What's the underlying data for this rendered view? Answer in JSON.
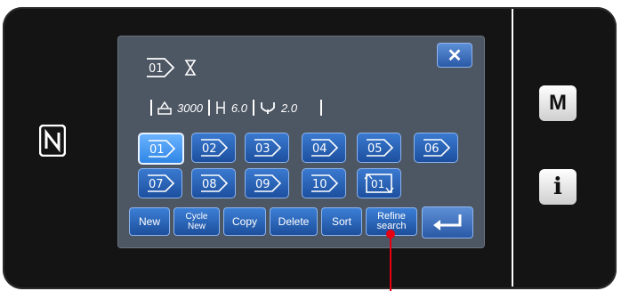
{
  "side_buttons": {
    "mode_label": "M",
    "info_label": "i"
  },
  "dialog": {
    "close_label": "✕",
    "current_pattern": "01",
    "info": {
      "speed": "3000",
      "stitch_length": "6.0",
      "needle_value": "2.0"
    },
    "patterns": [
      "01",
      "02",
      "03",
      "04",
      "05",
      "06",
      "07",
      "08",
      "09",
      "10",
      "01"
    ],
    "buttons": {
      "new": "New",
      "cycle_new_1": "Cycle",
      "cycle_new_2": "New",
      "copy": "Copy",
      "delete": "Delete",
      "sort": "Sort",
      "refine_1": "Refine",
      "refine_2": "search"
    }
  },
  "colors": {
    "accent": "#2f86e6",
    "callout": "#e60012"
  }
}
